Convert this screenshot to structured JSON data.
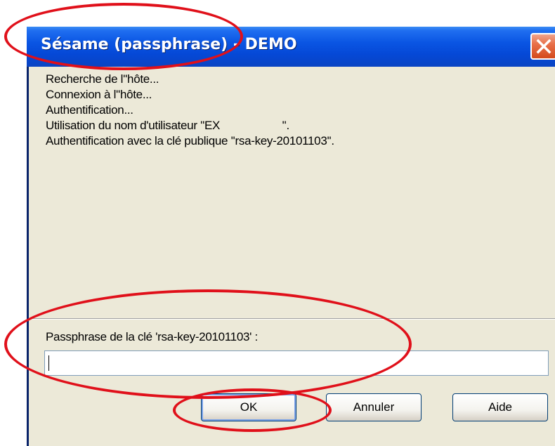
{
  "window": {
    "title": "Sésame (passphrase) - DEMO"
  },
  "log": {
    "lines": [
      "Recherche de l''hôte...",
      "Connexion à l''hôte...",
      "Authentification...",
      "Utilisation du nom d'utilisateur ''EX                    ''.",
      "Authentification avec la clé publique ''rsa-key-20101103''."
    ]
  },
  "prompt": {
    "label": "Passphrase de la clé 'rsa-key-20101103' :",
    "value": ""
  },
  "buttons": {
    "ok": "OK",
    "cancel": "Annuler",
    "help": "Aide"
  },
  "icons": {
    "close": "close-icon"
  },
  "colors": {
    "titlebar": "#0a55e3",
    "annotation": "#e0101a",
    "dialog_bg": "#ece9d8"
  }
}
